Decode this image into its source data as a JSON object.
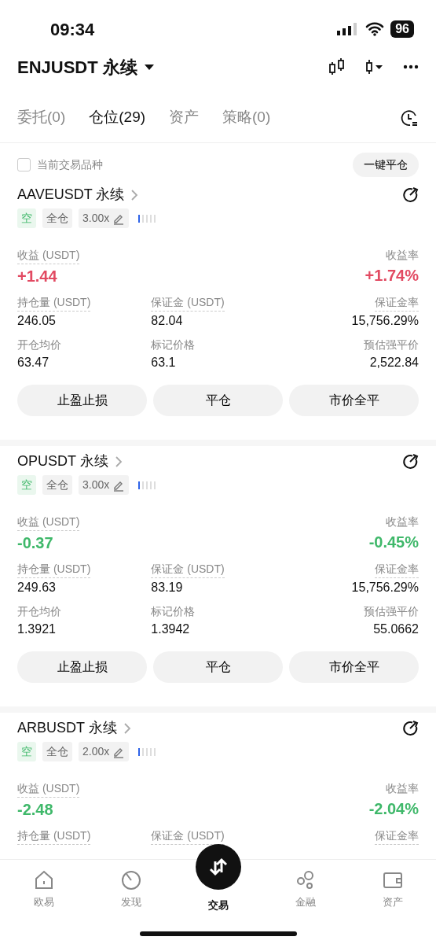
{
  "status_bar": {
    "time": "09:34",
    "battery": "96"
  },
  "header": {
    "title": "ENJUSDT 永续"
  },
  "tabs": [
    {
      "label": "委托(0)",
      "selected": false
    },
    {
      "label": "仓位(29)",
      "selected": true
    },
    {
      "label": "资产",
      "selected": false
    },
    {
      "label": "策略(0)",
      "selected": false
    }
  ],
  "filter": {
    "label": "当前交易品种",
    "checked": false,
    "close_all": "一键平仓"
  },
  "positions": [
    {
      "symbol": "AAVEUSDT 永续",
      "side": "空",
      "margin_mode": "全仓",
      "leverage": "3.00x",
      "level": 0.2,
      "pnl_label": "收益 (USDT)",
      "pnl": "+1.44",
      "roi_label": "收益率",
      "roi": "+1.74%",
      "color": "#e24a62",
      "metrics": [
        {
          "label": "持仓量 (USDT)",
          "value": "246.05"
        },
        {
          "label": "保证金 (USDT)",
          "value": "82.04"
        },
        {
          "label": "保证金率",
          "value": "15,756.29%"
        },
        {
          "label": "开仓均价",
          "value": "63.47"
        },
        {
          "label": "标记价格",
          "value": "63.1"
        },
        {
          "label": "预估强平价",
          "value": "2,522.84"
        }
      ],
      "buttons": [
        "止盈止损",
        "平仓",
        "市价全平"
      ]
    },
    {
      "symbol": "OPUSDT 永续",
      "side": "空",
      "margin_mode": "全仓",
      "leverage": "3.00x",
      "level": 0.2,
      "pnl_label": "收益 (USDT)",
      "pnl": "-0.37",
      "roi_label": "收益率",
      "roi": "-0.45%",
      "color": "#3fb86a",
      "metrics": [
        {
          "label": "持仓量 (USDT)",
          "value": "249.63"
        },
        {
          "label": "保证金 (USDT)",
          "value": "83.19"
        },
        {
          "label": "保证金率",
          "value": "15,756.29%"
        },
        {
          "label": "开仓均价",
          "value": "1.3921"
        },
        {
          "label": "标记价格",
          "value": "1.3942"
        },
        {
          "label": "预估强平价",
          "value": "55.0662"
        }
      ],
      "buttons": [
        "止盈止损",
        "平仓",
        "市价全平"
      ]
    },
    {
      "symbol": "ARBUSDT 永续",
      "side": "空",
      "margin_mode": "全仓",
      "leverage": "2.00x",
      "level": 0.2,
      "pnl_label": "收益 (USDT)",
      "pnl": "-2.48",
      "roi_label": "收益率",
      "roi": "-2.04%",
      "color": "#3fb86a",
      "metrics": [
        {
          "label": "持仓量 (USDT)"
        },
        {
          "label": "保证金 (USDT)"
        },
        {
          "label": "保证金率"
        }
      ]
    }
  ],
  "bottom_nav": [
    {
      "label": "欧易",
      "selected": false
    },
    {
      "label": "发现",
      "selected": false
    },
    {
      "label": "交易",
      "selected": true
    },
    {
      "label": "金融",
      "selected": false
    },
    {
      "label": "资产",
      "selected": false
    }
  ]
}
